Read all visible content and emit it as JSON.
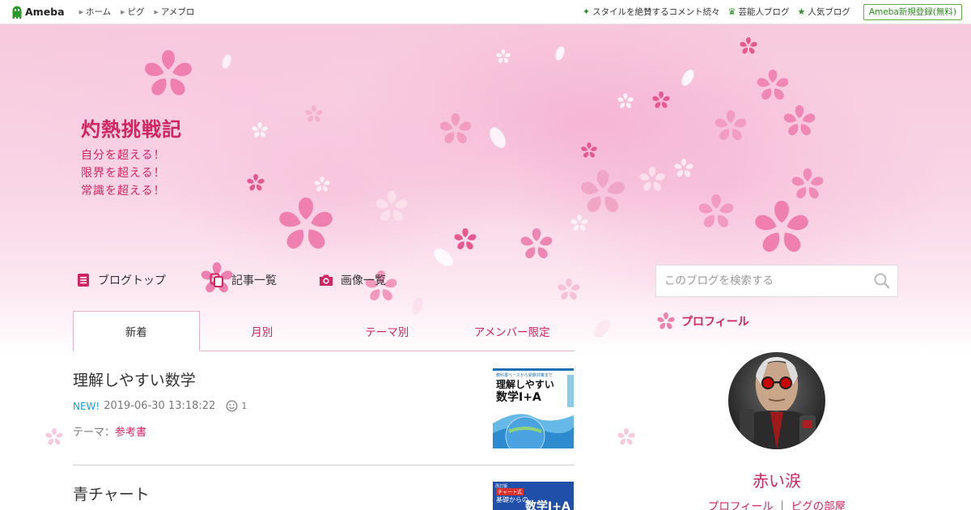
{
  "global_header": {
    "brand": "Ameba",
    "nav": [
      "ホーム",
      "ピグ",
      "アメブロ"
    ],
    "right_links": [
      {
        "label": "スタイルを絶賛するコメント続々",
        "icon": "sparkle-icon"
      },
      {
        "label": "芸能人ブログ",
        "icon": "crown-icon"
      },
      {
        "label": "人気ブログ",
        "icon": "star-icon"
      }
    ],
    "signup_label": "Ameba新規登録(無料)"
  },
  "blog": {
    "title": "灼熱挑戦記",
    "description": [
      "自分を超える！",
      "限界を超える！",
      "常識を超える！"
    ],
    "nav": {
      "top": "ブログトップ",
      "entries": "記事一覧",
      "images": "画像一覧"
    },
    "accent_color": "#d2245e"
  },
  "search": {
    "placeholder": "このブログを検索する"
  },
  "tabs": [
    "新着",
    "月別",
    "テーマ別",
    "アメンバー限定"
  ],
  "entries": [
    {
      "title": "理解しやすい数学",
      "badge": "NEW!",
      "datetime": "2019-06-30 13:18:22",
      "comments": "1",
      "theme_label": "テーマ：",
      "theme": "参考書",
      "thumb": {
        "top_text": "教科書ベースから受験対策まで",
        "main": "理解しやすい",
        "sub": "数学Ⅰ+A"
      }
    },
    {
      "title": "青チャート",
      "thumb": {
        "top_text": "改訂版",
        "badge": "チャート式",
        "line2": "基礎からの",
        "main": "数学Ⅰ+A"
      }
    }
  ],
  "profile": {
    "heading": "プロフィール",
    "name": "赤い涙",
    "links": [
      "プロフィール",
      "ピグの部屋"
    ]
  }
}
